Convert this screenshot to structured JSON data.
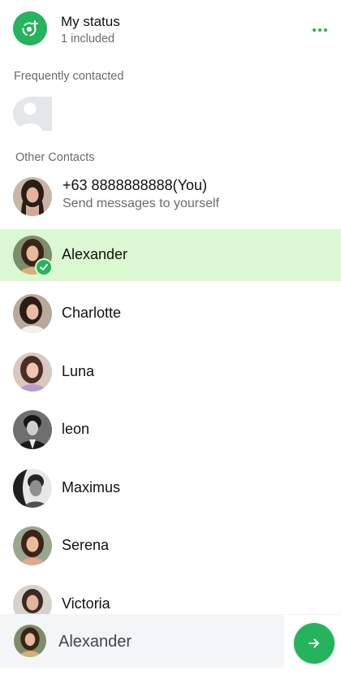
{
  "status": {
    "title": "My status",
    "subtitle": "1 included",
    "icon": "status-ring-icon",
    "more_icon": "more-horizontal-icon"
  },
  "sections": {
    "frequent": "Frequently contacted",
    "other": "Other Contacts"
  },
  "self_contact": {
    "name": "+63 8888888888(You)",
    "subtitle": "Send messages to yourself"
  },
  "contacts": [
    {
      "name": "Alexander",
      "selected": true
    },
    {
      "name": "Charlotte",
      "selected": false
    },
    {
      "name": "Luna",
      "selected": false
    },
    {
      "name": "leon",
      "selected": false
    },
    {
      "name": "Maximus",
      "selected": false
    },
    {
      "name": "Serena",
      "selected": false
    },
    {
      "name": "Victoria",
      "selected": false
    }
  ],
  "selection_bar": {
    "selected_name": "Alexander",
    "send_icon": "arrow-right-icon"
  },
  "colors": {
    "accent": "#25b35d",
    "selected_row": "#dcf8d2"
  }
}
